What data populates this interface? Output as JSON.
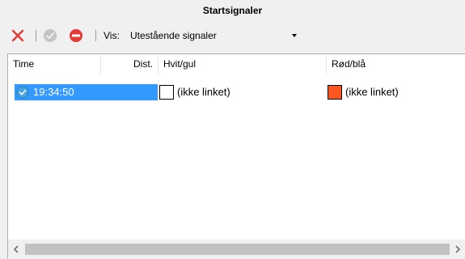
{
  "window": {
    "title": "Startsignaler"
  },
  "toolbar": {
    "vis_label": "Vis:",
    "vis_selected": "Utestående signaler",
    "icons": [
      "close-x-icon",
      "ok-icon",
      "stop-icon"
    ]
  },
  "table": {
    "columns": [
      "Time",
      "Dist.",
      "Hvit/gul",
      "Rød/blå"
    ],
    "rows": [
      {
        "time": "19:34:50",
        "dist": "",
        "hvit_gul": {
          "text": "(ikke linket)",
          "color": "#ffffff"
        },
        "rod_bla": {
          "text": "(ikke linket)",
          "color": "#ff5722"
        }
      }
    ]
  },
  "colors": {
    "selection": "#3399ff",
    "toolbar_close": "#e53935",
    "toolbar_stop": "#e53935",
    "check_icon": "#4aa3df"
  }
}
